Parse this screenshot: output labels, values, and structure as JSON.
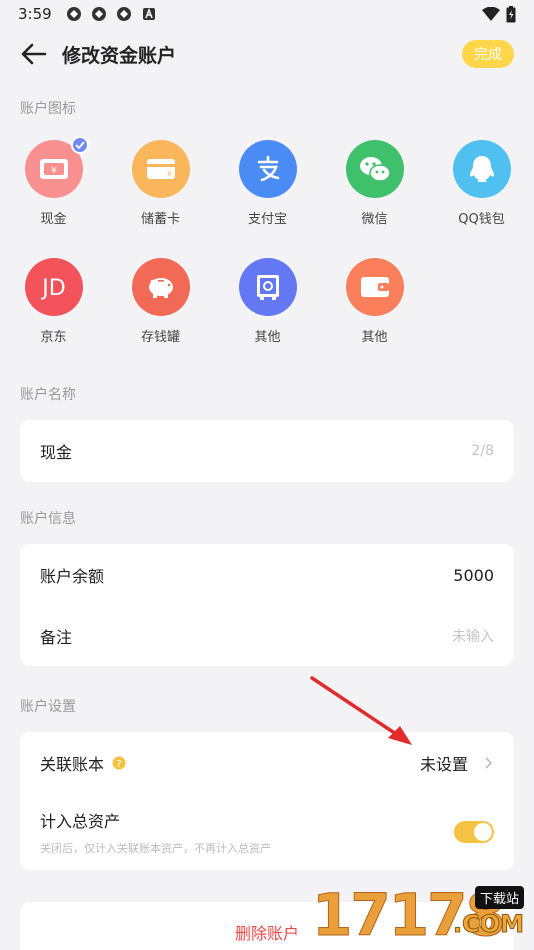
{
  "status_bar": {
    "time": "3:59"
  },
  "header": {
    "title": "修改资金账户",
    "done_label": "完成"
  },
  "icons_section": {
    "label": "账户图标",
    "items": [
      {
        "label": "现金",
        "icon": "cash-icon",
        "color": "#f8908f",
        "selected": true
      },
      {
        "label": "储蓄卡",
        "icon": "bank-card-icon",
        "color": "#fbb65c"
      },
      {
        "label": "支付宝",
        "icon": "alipay-icon",
        "color": "#4a8cf4"
      },
      {
        "label": "微信",
        "icon": "wechat-icon",
        "color": "#3fc06b"
      },
      {
        "label": "QQ钱包",
        "icon": "qq-wallet-icon",
        "color": "#4fc0f0"
      },
      {
        "label": "京东",
        "icon": "jd-icon",
        "color": "#f2525a"
      },
      {
        "label": "存钱罐",
        "icon": "piggy-bank-icon",
        "color": "#f26a55"
      },
      {
        "label": "其他",
        "icon": "safe-icon",
        "color": "#6478f4"
      },
      {
        "label": "其他",
        "icon": "wallet-icon",
        "color": "#fb7f5a"
      }
    ]
  },
  "name_section": {
    "label": "账户名称",
    "value": "现金",
    "counter": "2/8"
  },
  "info_section": {
    "label": "账户信息",
    "balance_label": "账户余额",
    "balance_value": "5000",
    "note_label": "备注",
    "note_placeholder": "未输入"
  },
  "settings_section": {
    "label": "账户设置",
    "ledger_label": "关联账本",
    "ledger_value": "未设置",
    "total_label": "计入总资产",
    "total_hint": "关闭后，仅计入关联账本资产，不再计入总资产",
    "total_enabled": true
  },
  "delete_label": "删除账户",
  "watermark": {
    "digits": "17178",
    "badge": "下载站",
    "domain": ".COM"
  }
}
